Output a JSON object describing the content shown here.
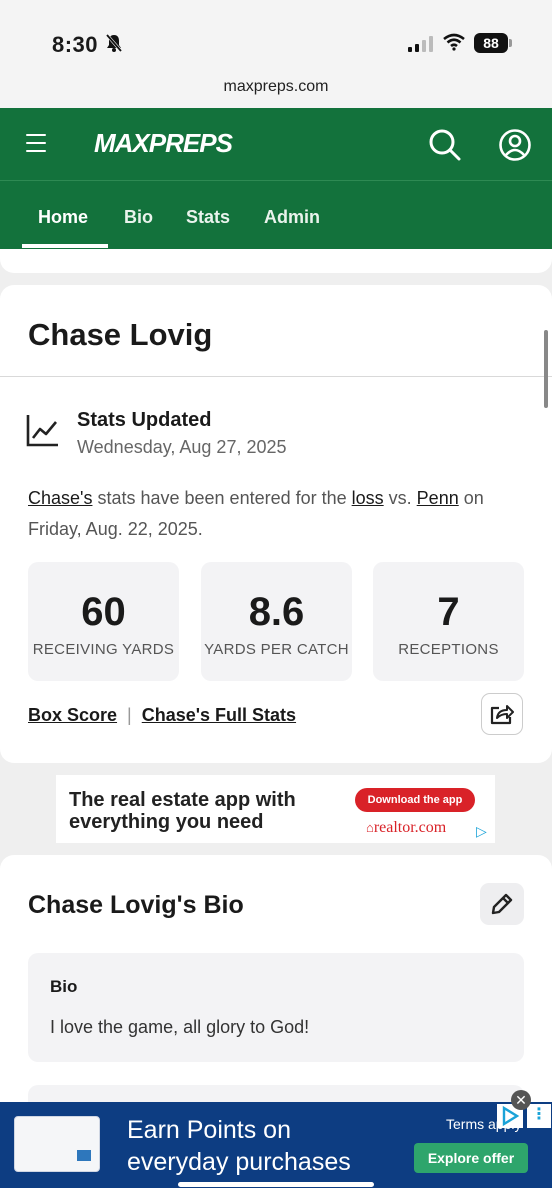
{
  "status_bar": {
    "time": "8:30",
    "battery": "88"
  },
  "browser": {
    "url": "maxpreps.com"
  },
  "header": {
    "logo": "MAXPREPS"
  },
  "tabs": [
    {
      "label": "Home",
      "active": true
    },
    {
      "label": "Bio"
    },
    {
      "label": "Stats"
    },
    {
      "label": "Admin"
    }
  ],
  "player": {
    "name": "Chase Lovig"
  },
  "stats_update": {
    "title": "Stats Updated",
    "date": "Wednesday, Aug 27, 2025",
    "text_player": "Chase's",
    "text_mid1": " stats have been entered for the ",
    "text_result": "loss",
    "text_mid2": " vs. ",
    "text_opponent": "Penn",
    "text_end": " on Friday, Aug. 22, 2025."
  },
  "stats": [
    {
      "value": "60",
      "label": "RECEIVING YARDS"
    },
    {
      "value": "8.6",
      "label": "YARDS PER CATCH"
    },
    {
      "value": "7",
      "label": "RECEPTIONS"
    }
  ],
  "links": {
    "box_score": "Box Score",
    "full_stats": "Chase's Full Stats",
    "separator": "|"
  },
  "ad_realtor": {
    "headline_1": "The real estate app with",
    "headline_2": "everything you need",
    "cta": "Download the app",
    "brand": "realtor.com"
  },
  "bio": {
    "title": "Chase Lovig's Bio",
    "label": "Bio",
    "text": "I love the game, all glory to God!"
  },
  "ad_card": {
    "headline_1": "Earn Points on",
    "headline_2": "everyday purchases",
    "terms": "Terms apply",
    "cta": "Explore offer",
    "close": "✕"
  },
  "colors": {
    "brand_green": "#13723c",
    "ad_blue": "#0d3d82",
    "cta_green": "#2ea56c",
    "realtor_red": "#d92228"
  }
}
